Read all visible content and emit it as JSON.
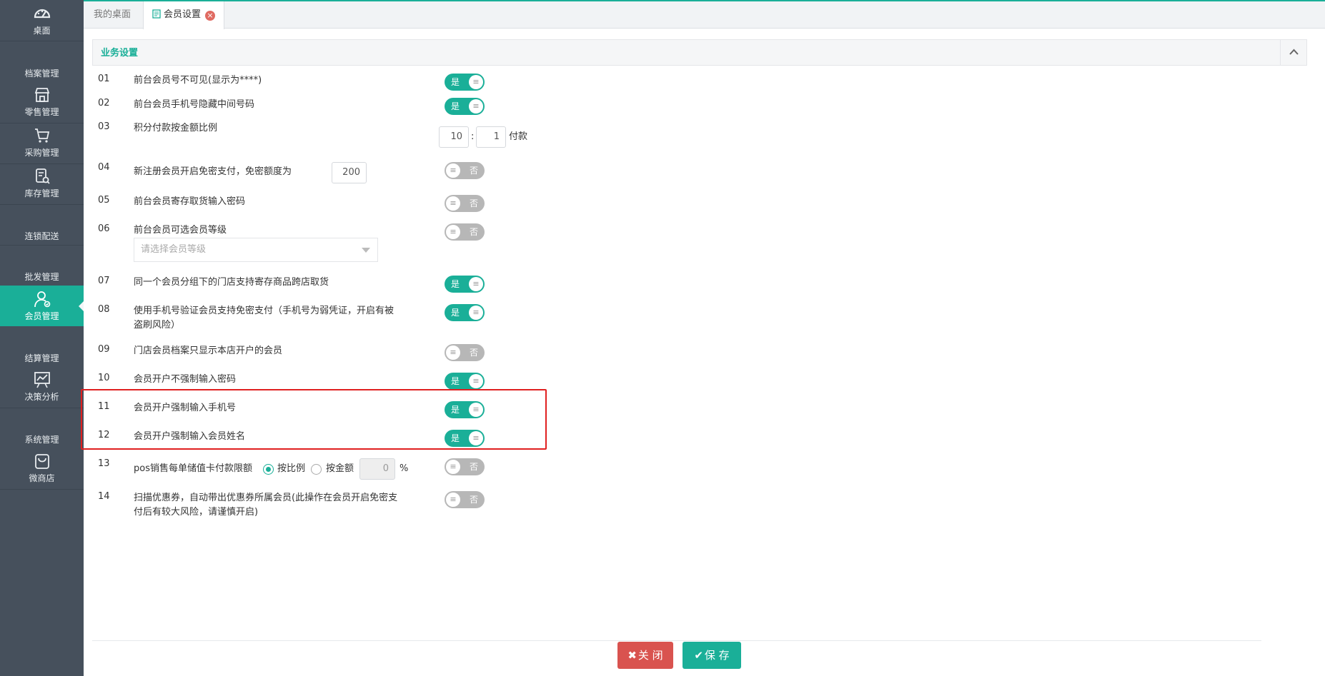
{
  "sidebar": {
    "items": [
      {
        "label": "桌面",
        "icon": "dashboard-icon"
      },
      {
        "label": "档案管理",
        "icon": ""
      },
      {
        "label": "零售管理",
        "icon": "store-icon"
      },
      {
        "label": "采购管理",
        "icon": "cart-icon"
      },
      {
        "label": "库存管理",
        "icon": "inventory-icon"
      },
      {
        "label": "连锁配送",
        "icon": ""
      },
      {
        "label": "批发管理",
        "icon": ""
      },
      {
        "label": "会员管理",
        "icon": "member-icon",
        "active": true
      },
      {
        "label": "结算管理",
        "icon": ""
      },
      {
        "label": "决策分析",
        "icon": "chart-icon"
      },
      {
        "label": "系统管理",
        "icon": ""
      },
      {
        "label": "微商店",
        "icon": "bag-icon"
      }
    ]
  },
  "tabs": [
    {
      "label": "我的桌面"
    },
    {
      "label": "会员设置",
      "active": true
    }
  ],
  "panel": {
    "title": "业务设置"
  },
  "settings": [
    {
      "num": "01",
      "text": "前台会员号不可见(显示为****)",
      "on": true
    },
    {
      "num": "02",
      "text": "前台会员手机号隐藏中间号码",
      "on": true
    },
    {
      "num": "03",
      "text": "积分付款按金额比例",
      "ratio_left": "10",
      "ratio_sep": ":",
      "ratio_right": "1",
      "suffix": "付款"
    },
    {
      "num": "04",
      "text": "新注册会员开启免密支付，免密额度为",
      "amount": "200",
      "on": false
    },
    {
      "num": "05",
      "text": "前台会员寄存取货输入密码",
      "on": false
    },
    {
      "num": "06",
      "text": "前台会员可选会员等级",
      "select_placeholder": "请选择会员等级",
      "on": false
    },
    {
      "num": "07",
      "text": "同一个会员分组下的门店支持寄存商品跨店取货",
      "on": true
    },
    {
      "num": "08",
      "text": "使用手机号验证会员支持免密支付（手机号为弱凭证，开启有被",
      "text2": "盗刷风险）",
      "on": true
    },
    {
      "num": "09",
      "text": "门店会员档案只显示本店开户的会员",
      "on": false
    },
    {
      "num": "10",
      "text": "会员开户不强制输入密码",
      "on": true
    },
    {
      "num": "11",
      "text": "会员开户强制输入手机号",
      "on": true
    },
    {
      "num": "12",
      "text": "会员开户强制输入会员姓名",
      "on": true
    },
    {
      "num": "13",
      "text": "pos销售每单储值卡付款限额",
      "opt1": "按比例",
      "opt2": "按金额",
      "limit": "0",
      "unit": "%",
      "on": false
    },
    {
      "num": "14",
      "text": "扫描优惠券，自动带出优惠券所属会员(此操作在会员开启免密支",
      "text2": "付后有较大风险，请谨慎开启)",
      "on": false
    }
  ],
  "switch": {
    "on_label": "是",
    "off_label": "否",
    "knob": "≡"
  },
  "footer": {
    "close_label": "关 闭",
    "close_icon": "✖",
    "save_label": "保 存",
    "save_icon": "✔"
  },
  "colors": {
    "accent": "#1aaf98",
    "danger": "#d9534f",
    "sidebar": "#46505c",
    "highlight": "#e02020"
  }
}
